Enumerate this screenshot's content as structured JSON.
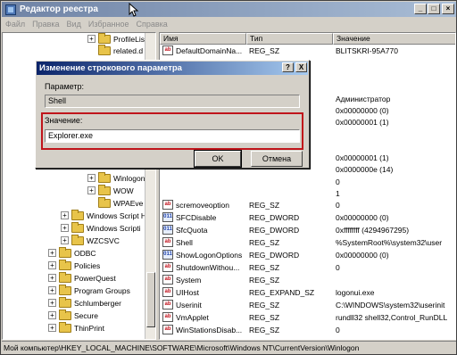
{
  "window": {
    "title": "Редактор реестра"
  },
  "menu": [
    "Файл",
    "Правка",
    "Вид",
    "Избранное",
    "Справка"
  ],
  "tree": {
    "items": [
      {
        "label": "ProfileLis",
        "expander": "+"
      },
      {
        "label": "related.d",
        "expander": ""
      },
      {
        "label": "Winlogon",
        "expander": "+"
      },
      {
        "label": "WOW",
        "expander": "+"
      },
      {
        "label": "WPAEve",
        "expander": ""
      },
      {
        "label": "Windows Script H",
        "expander": "+"
      },
      {
        "label": "Windows Scripti",
        "expander": "+"
      },
      {
        "label": "WZCSVC",
        "expander": "+"
      },
      {
        "label": "ODBC",
        "expander": "+"
      },
      {
        "label": "Policies",
        "expander": "+"
      },
      {
        "label": "PowerQuest",
        "expander": "+"
      },
      {
        "label": "Program Groups",
        "expander": "+"
      },
      {
        "label": "Schlumberger",
        "expander": "+"
      },
      {
        "label": "Secure",
        "expander": "+"
      },
      {
        "label": "ThinPrint",
        "expander": "+"
      }
    ]
  },
  "list": {
    "columns": [
      "Имя",
      "Тип",
      "Значение"
    ],
    "rows": [
      {
        "icon": "ab",
        "name": "DefaultDomainNa...",
        "type": "REG_SZ",
        "value": "BLITSKRI-95A770"
      },
      {
        "icon": "",
        "name": "",
        "type": "",
        "value": "Администратор"
      },
      {
        "icon": "",
        "name": "",
        "type": "",
        "value": "0x00000000 (0)"
      },
      {
        "icon": "",
        "name": "",
        "type": "",
        "value": "0x00000001 (1)"
      },
      {
        "icon": "",
        "name": "",
        "type": "",
        "value": "0x00000001 (1)"
      },
      {
        "icon": "",
        "name": "",
        "type": "",
        "value": "0x0000000e (14)"
      },
      {
        "icon": "",
        "name": "",
        "type": "",
        "value": "0"
      },
      {
        "icon": "",
        "name": "",
        "type": "",
        "value": "1"
      },
      {
        "icon": "ab",
        "name": "scremoveoption",
        "type": "REG_SZ",
        "value": "0"
      },
      {
        "icon": "dw",
        "name": "SFCDisable",
        "type": "REG_DWORD",
        "value": "0x00000000 (0)"
      },
      {
        "icon": "dw",
        "name": "SfcQuota",
        "type": "REG_DWORD",
        "value": "0xffffffff (4294967295)"
      },
      {
        "icon": "ab",
        "name": "Shell",
        "type": "REG_SZ",
        "value": "%SystemRoot%\\system32\\user"
      },
      {
        "icon": "dw",
        "name": "ShowLogonOptions",
        "type": "REG_DWORD",
        "value": "0x00000000 (0)"
      },
      {
        "icon": "ab",
        "name": "ShutdownWithou...",
        "type": "REG_SZ",
        "value": "0"
      },
      {
        "icon": "ab",
        "name": "System",
        "type": "REG_SZ",
        "value": ""
      },
      {
        "icon": "ab",
        "name": "UIHost",
        "type": "REG_EXPAND_SZ",
        "value": "logonui.exe"
      },
      {
        "icon": "ab",
        "name": "Userinit",
        "type": "REG_SZ",
        "value": "C:\\WINDOWS\\system32\\userinit"
      },
      {
        "icon": "ab",
        "name": "VmApplet",
        "type": "REG_SZ",
        "value": "rundll32 shell32,Control_RunDLL"
      },
      {
        "icon": "ab",
        "name": "WinStationsDisab...",
        "type": "REG_SZ",
        "value": "0"
      }
    ]
  },
  "dialog": {
    "title": "Изменение строкового параметра",
    "help_label": "?",
    "close_label": "X",
    "param_label": "Параметр:",
    "param_value": "Shell",
    "value_label": "Значение:",
    "value_value": "Explorer.exe",
    "ok_label": "OK",
    "cancel_label": "Отмена"
  },
  "statusbar": {
    "path": "Мой компьютер\\HKEY_LOCAL_MACHINE\\SOFTWARE\\Microsoft\\Windows NT\\CurrentVersion\\Winlogon"
  },
  "colors": {
    "highlight": "#c0151b",
    "dialog_title_start": "#0a246a",
    "dialog_title_end": "#a6caf0"
  }
}
